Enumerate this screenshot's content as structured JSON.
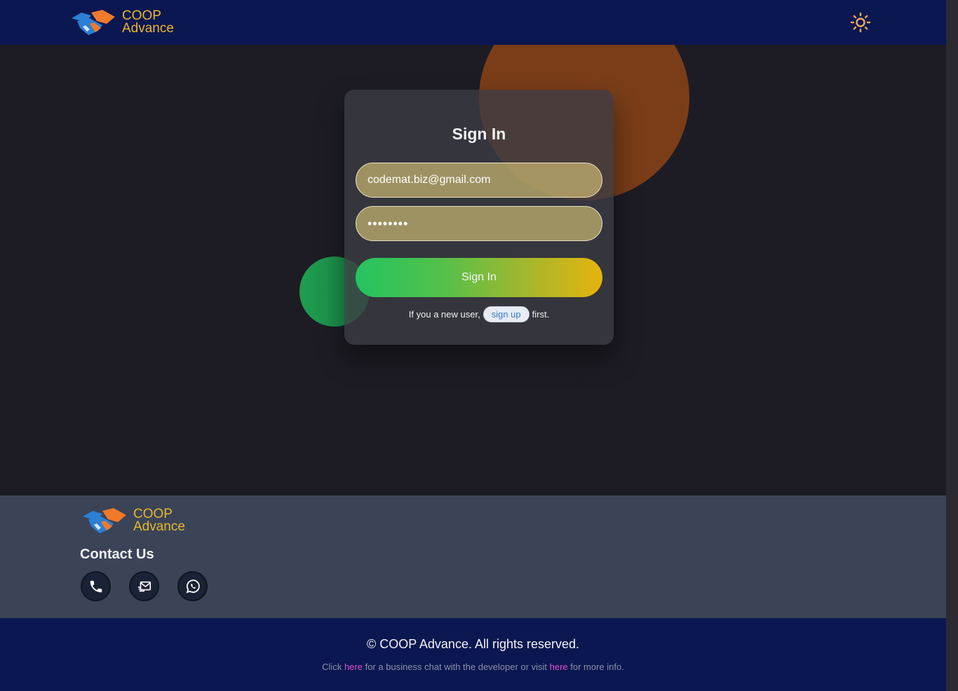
{
  "header": {
    "brand": {
      "line1": "COOP",
      "line2": "Advance",
      "logo_icon": "handshake-icon"
    },
    "theme_toggle_icon": "sun-icon"
  },
  "signin": {
    "title": "Sign In",
    "email_value": "codemat.biz@gmail.com",
    "password_value": "••••••••",
    "button_label": "Sign In",
    "new_user_prefix": "If you a new user,",
    "signup_label": "sign up",
    "new_user_suffix": "first."
  },
  "footer": {
    "brand": {
      "line1": "COOP",
      "line2": "Advance",
      "logo_icon": "handshake-icon"
    },
    "contact_title": "Contact Us",
    "contacts": [
      {
        "icon": "phone-icon"
      },
      {
        "icon": "mail-icon"
      },
      {
        "icon": "whatsapp-icon"
      }
    ],
    "copyright": "© COOP Advance. All rights reserved.",
    "info": {
      "part1": "Click ",
      "link1": "here",
      "part2": " for a business chat with the developer or visit ",
      "link2": "here",
      "part3": " for more info."
    }
  },
  "colors": {
    "header_bg": "#0b1750",
    "brand_text": "#e9b630",
    "footer_bg": "#3a4456",
    "link": "#e04fd1",
    "button_gradient_start": "#24c461",
    "button_gradient_end": "#e7b30c"
  }
}
